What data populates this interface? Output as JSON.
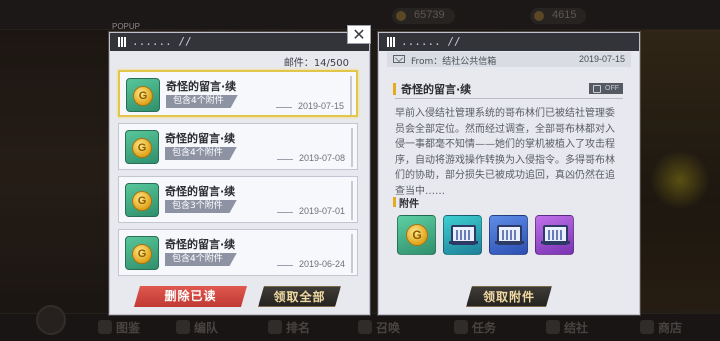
{
  "background": {
    "currency_values": [
      "65739",
      "4615"
    ],
    "bottom_tabs": [
      "图鉴",
      "编队",
      "排名",
      "召唤",
      "任务",
      "结社",
      "商店"
    ]
  },
  "popup_tag": "POPUP",
  "left_panel": {
    "header_path": "...... //",
    "mail_count_label": "邮件：",
    "mail_count": "14/500",
    "mails": [
      {
        "title": "奇怪的留言·续",
        "badge": "包含4个附件",
        "date": "2019-07-15",
        "selected": true
      },
      {
        "title": "奇怪的留言·续",
        "badge": "包含4个附件",
        "date": "2019-07-08",
        "selected": false
      },
      {
        "title": "奇怪的留言·续",
        "badge": "包含3个附件",
        "date": "2019-07-01",
        "selected": false
      },
      {
        "title": "奇怪的留言·续",
        "badge": "包含4个附件",
        "date": "2019-06-24",
        "selected": false
      }
    ],
    "delete_read_label": "删除已读",
    "claim_all_label": "领取全部"
  },
  "close_label": "✕",
  "right_panel": {
    "header_path": "...... //",
    "from": "From：结社公共信箱",
    "date": "2019-07-15",
    "title": "奇怪的留言·续",
    "lock_badge": "OFF",
    "body": "早前入侵结社管理系统的哥布林们已被结社管理委员会全部定位。然而经过调查，全部哥布林都对入侵一事都毫不知情——她们的掌机被植入了攻击程序，自动将游戏操作转换为入侵指令。多得哥布林们的协助，部分损失已被成功追回，真凶仍然在追查当中……",
    "attachments_label": "附件",
    "attachments": [
      {
        "icon": "gold-coin-icon",
        "color": "green"
      },
      {
        "icon": "data-chip-icon",
        "color": "teal"
      },
      {
        "icon": "data-chip-icon",
        "color": "blue"
      },
      {
        "icon": "data-chip-icon",
        "color": "purple"
      }
    ],
    "claim_attachment_label": "领取附件"
  },
  "colors": {
    "accent_gold": "#e8a91e",
    "delete_red": "#d04a42",
    "selected_border": "#e3c54a"
  }
}
